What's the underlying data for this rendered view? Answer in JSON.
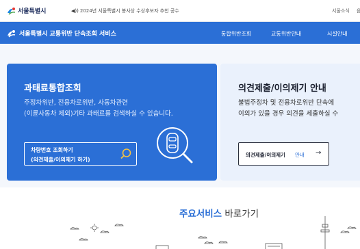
{
  "topbar": {
    "logo_text": "서울특별시",
    "notice": "2024년 서울특별시 봉사상 수상후보자 추천 공수",
    "link_sitemap": "서울소식",
    "link_extra": "음"
  },
  "navbar": {
    "brand": "서울특별시 교통위반 단속조회 서비스",
    "items": [
      "통합위반조회",
      "교통위반안내",
      "시설안내"
    ]
  },
  "card_fine": {
    "title": "과태료통합조회",
    "desc_line1": "주정차위반, 전용차로위반, 사동차관련",
    "desc_line2": "(이륜사동차 제외)기타 과태료를 검색하실 수 있습니다.",
    "button_line1": "차량번호 조회하기",
    "button_line2": "(의견제출/이의제기 하기)"
  },
  "card_objection": {
    "title": "의견제출/이의제기 안내",
    "desc_line1": "불법주정차 및 전용차로위반 단속에",
    "desc_line2": "이의가 있을 경우 의견을 세출하실 수",
    "button_label": "의견제출/이의제기",
    "button_label_accent": "안내",
    "button_arrow": "→"
  },
  "main_services": {
    "title_accent": "주요서비스",
    "title_rest": " 바로가기"
  },
  "colors": {
    "brand_blue": "#2b6fd6",
    "navy": "#1a2a5a",
    "light_card": "#eaf1fc"
  },
  "icons": [
    "seoul-logo-icon",
    "speaker-icon",
    "search-icon",
    "car-scan-icon",
    "arrow-right-icon"
  ]
}
